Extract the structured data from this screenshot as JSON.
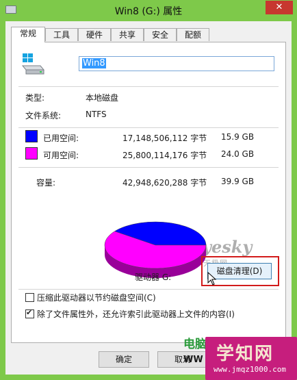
{
  "window": {
    "title": "Win8 (G:) 属性",
    "close_glyph": "✕",
    "icons": {
      "app": "drive-icon",
      "close": "close-icon"
    }
  },
  "tabs": [
    "常规",
    "工具",
    "硬件",
    "共享",
    "安全",
    "配额"
  ],
  "active_tab": "常规",
  "general": {
    "drive_name": "Win8",
    "type_label": "类型:",
    "type_value": "本地磁盘",
    "fs_label": "文件系统:",
    "fs_value": "NTFS",
    "used_label": "已用空间:",
    "used_bytes": "17,148,506,112 字节",
    "used_gb": "15.9 GB",
    "free_label": "可用空间:",
    "free_bytes": "25,800,114,176 字节",
    "free_gb": "24.0 GB",
    "capacity_label": "容量:",
    "capacity_bytes": "42,948,620,288 字节",
    "capacity_gb": "39.9 GB",
    "drive_letter_label": "驱动器 G:",
    "cleanup_button": "磁盘清理(D)",
    "compress_label": "压缩此驱动器以节约磁盘空间(C)",
    "compress_checked": false,
    "index_label": "除了文件属性外，还允许索引此驱动器上文件的内容(I)",
    "index_checked": true,
    "colors": {
      "used": "#0000ff",
      "free": "#ff00ff",
      "highlight": "#d21a1a"
    }
  },
  "chart_data": {
    "type": "pie",
    "categories": [
      "已用空间",
      "可用空间"
    ],
    "values": [
      15.9,
      24.0
    ],
    "colors": [
      "#0000ff",
      "#ff00ff"
    ]
  },
  "footer": {
    "ok_button": "确定",
    "cancel_button": "取消"
  },
  "watermarks": {
    "yesky": "yesky",
    "yesky_cn": "天极网",
    "right_main": "学知网",
    "right_url": "www.jmqz1000.com",
    "left_cn": "电脑",
    "left_wm": "WW"
  }
}
